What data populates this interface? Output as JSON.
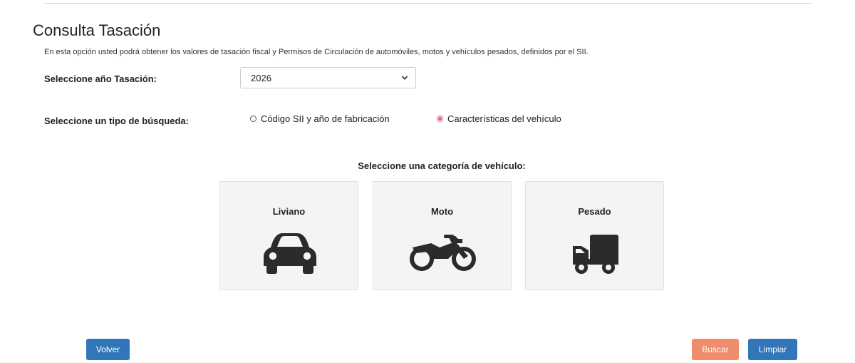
{
  "page": {
    "title": "Consulta Tasación",
    "intro": "En esta opción usted podrá obtener los valores de tasación fiscal y Permisos de Circulación de automóviles, motos y vehículos pesados, definidos por el SII."
  },
  "year": {
    "label": "Seleccione año Tasación:",
    "selected": "2026"
  },
  "search_type": {
    "label": "Seleccione un tipo de búsqueda:",
    "options": [
      {
        "label": "Código SII y año de fabricación",
        "checked": false
      },
      {
        "label": "Características del vehículo",
        "checked": true
      }
    ]
  },
  "category": {
    "heading": "Seleccione una categoría de vehículo:",
    "cards": [
      {
        "label": "Liviano",
        "icon": "car-icon"
      },
      {
        "label": "Moto",
        "icon": "motorcycle-icon"
      },
      {
        "label": "Pesado",
        "icon": "truck-icon"
      }
    ]
  },
  "actions": {
    "back_label": "Volver",
    "search_label": "Buscar",
    "clear_label": "Limpiar"
  },
  "colors": {
    "primary": "#3176b8",
    "search": "#ef8c69",
    "radio_checked": "#e0569f",
    "card_bg": "#f4f4f4"
  }
}
